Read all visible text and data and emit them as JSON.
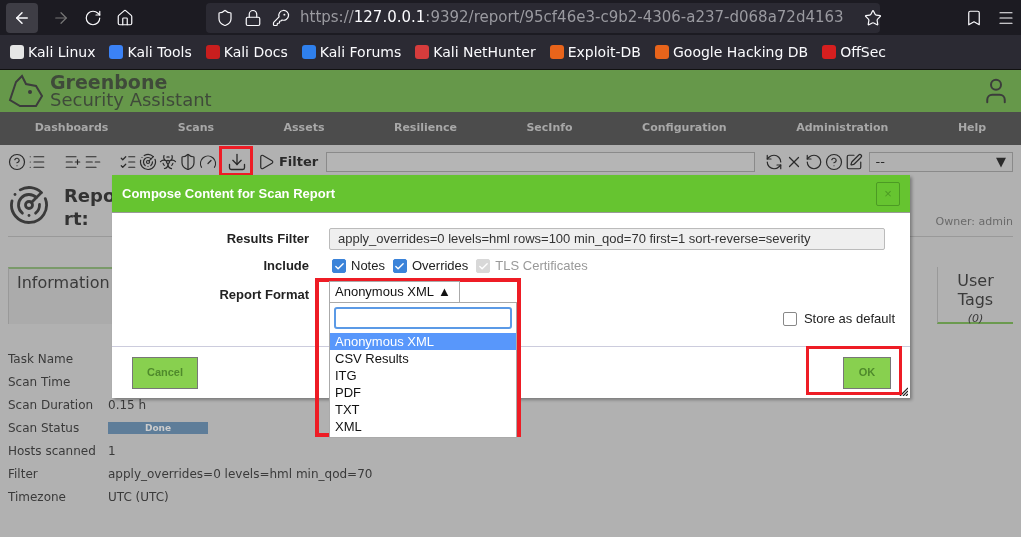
{
  "browser": {
    "url": {
      "scheme": "https://",
      "host": "127.0.0.1",
      "path": ":9392/report/95cf46e3-c9b2-4306-a237-d068a72d4163"
    },
    "bookmarks": [
      {
        "label": "Kali Linux",
        "color": "#e5e5e5"
      },
      {
        "label": "Kali Tools",
        "color": "#3b82f6"
      },
      {
        "label": "Kali Docs",
        "color": "#c81e1e"
      },
      {
        "label": "Kali Forums",
        "color": "#2f80ed"
      },
      {
        "label": "Kali NetHunter",
        "color": "#d63c3c"
      },
      {
        "label": "Exploit-DB",
        "color": "#e8641b"
      },
      {
        "label": "Google Hacking DB",
        "color": "#e8641b"
      },
      {
        "label": "OffSec",
        "color": "#d61f1f"
      }
    ]
  },
  "app": {
    "brand": {
      "name": "Greenbone",
      "subtitle": "Security Assistant"
    },
    "nav": [
      "Dashboards",
      "Scans",
      "Assets",
      "Resilience",
      "SecInfo",
      "Configuration",
      "Administration",
      "Help"
    ],
    "toolbar": {
      "filter_label": "Filter",
      "filter_select": "--",
      "dropdown_arrow": "▼"
    },
    "report": {
      "title_lines": [
        "Repo",
        "rt:"
      ],
      "owner": "Owner: admin",
      "tabs": [
        {
          "label": "Information",
          "selected": true
        },
        {
          "label": "User Tags",
          "count": "(0)",
          "selected": false
        }
      ],
      "details": [
        {
          "label": "Task Name",
          "kind": "text"
        },
        {
          "label": "Scan Time",
          "kind": "text"
        },
        {
          "label": "Scan Duration",
          "kind": "text",
          "value": "0.15 h"
        },
        {
          "label": "Scan Status",
          "kind": "status",
          "value": "Done",
          "level": 1
        },
        {
          "label": "Hosts scanned",
          "kind": "text",
          "value": "1"
        },
        {
          "label": "Filter",
          "kind": "text",
          "value": "apply_overrides=0 levels=hml min_qod=70"
        },
        {
          "label": "Timezone",
          "kind": "text",
          "value": "UTC (UTC)"
        }
      ]
    }
  },
  "dialog": {
    "title": "Compose Content for Scan Report",
    "close": "×",
    "results_filter": {
      "label": "Results Filter",
      "value": "apply_overrides=0 levels=hml rows=100 min_qod=70 first=1 sort-reverse=severity"
    },
    "include": {
      "label": "Include",
      "options": [
        {
          "label": "Notes",
          "checked": true,
          "disabled": false
        },
        {
          "label": "Overrides",
          "checked": true,
          "disabled": false
        },
        {
          "label": "TLS Certificates",
          "checked": true,
          "disabled": true
        }
      ]
    },
    "report_format": {
      "label": "Report Format",
      "value": "Anonymous XML",
      "arrow": "▲",
      "expanded": true,
      "options": [
        {
          "label": "Anonymous XML",
          "selected": true
        },
        {
          "label": "CSV Results",
          "selected": false
        },
        {
          "label": "ITG",
          "selected": false
        },
        {
          "label": "PDF",
          "selected": false
        },
        {
          "label": "TXT",
          "selected": false
        },
        {
          "label": "XML",
          "selected": false
        }
      ]
    },
    "store_default": {
      "label": "Store as default",
      "checked": false
    },
    "buttons": {
      "cancel": "Cancel",
      "ok": "OK"
    }
  }
}
